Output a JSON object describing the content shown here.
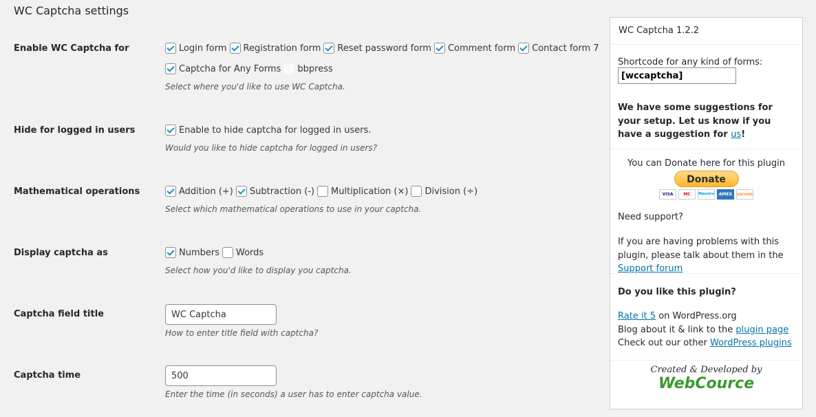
{
  "page": {
    "title": "WC Captcha settings"
  },
  "rows": {
    "enable": {
      "label": "Enable WC Captcha for",
      "options": [
        {
          "label": "Login form",
          "checked": true
        },
        {
          "label": "Registration form",
          "checked": true
        },
        {
          "label": "Reset password form",
          "checked": true
        },
        {
          "label": "Comment form",
          "checked": true
        },
        {
          "label": "Contact form 7",
          "checked": true
        },
        {
          "label": "Captcha for Any Forms",
          "checked": true
        },
        {
          "label": "bbpress",
          "checked": false
        }
      ],
      "description": "Select where you'd like to use WC Captcha."
    },
    "hide": {
      "label": "Hide for logged in users",
      "option": {
        "label": "Enable to hide captcha for logged in users.",
        "checked": true
      },
      "description": "Would you like to hide captcha for logged in users?"
    },
    "math": {
      "label": "Mathematical operations",
      "options": [
        {
          "label": "Addition (+)",
          "checked": true
        },
        {
          "label": "Subtraction (-)",
          "checked": true
        },
        {
          "label": "Multiplication (×)",
          "checked": false
        },
        {
          "label": "Division (÷)",
          "checked": false
        }
      ],
      "description": "Select which mathematical operations to use in your captcha."
    },
    "display": {
      "label": "Display captcha as",
      "options": [
        {
          "label": "Numbers",
          "checked": true
        },
        {
          "label": "Words",
          "checked": false
        }
      ],
      "description": "Select how you'd like to display you captcha."
    },
    "title": {
      "label": "Captcha field title",
      "value": "WC Captcha",
      "description": "How to enter title field with captcha?"
    },
    "time": {
      "label": "Captcha time",
      "value": "500",
      "description": "Enter the time (in seconds) a user has to enter captcha value."
    }
  },
  "sidebar": {
    "title": "WC Captcha 1.2.2",
    "shortcode_label": "Shortcode for any kind of forms:",
    "shortcode_value": "[wccaptcha]",
    "suggest_text": "We have some suggestions for your setup. Let us know if you have a suggestion for",
    "suggest_link": "us",
    "suggest_end": "!",
    "donate_text": "You can Donate here for this plugin",
    "donate_button": "Donate",
    "cards": [
      "VISA",
      "MC",
      "Maestro",
      "AMEX",
      "DISCOVER"
    ],
    "support_heading": "Need support?",
    "support_text": "If you are having problems with this plugin, please talk about them in the",
    "support_link": "Support forum",
    "like_heading": "Do you like this plugin?",
    "rate_link": "Rate it 5",
    "rate_suffix": " on WordPress.org",
    "blog_text": "Blog about it & link to the ",
    "blog_link": "plugin page",
    "other_text": "Check out our other ",
    "other_link": "WordPress plugins",
    "credit": "Created & Developed by",
    "brand": "WebCource"
  },
  "colors": {
    "background": "#f1f1f1",
    "link": "#0073aa",
    "checkmark": "#1e8cbe",
    "brand_green": "#3a9b2d",
    "donate_yellow": "#ffc439"
  }
}
